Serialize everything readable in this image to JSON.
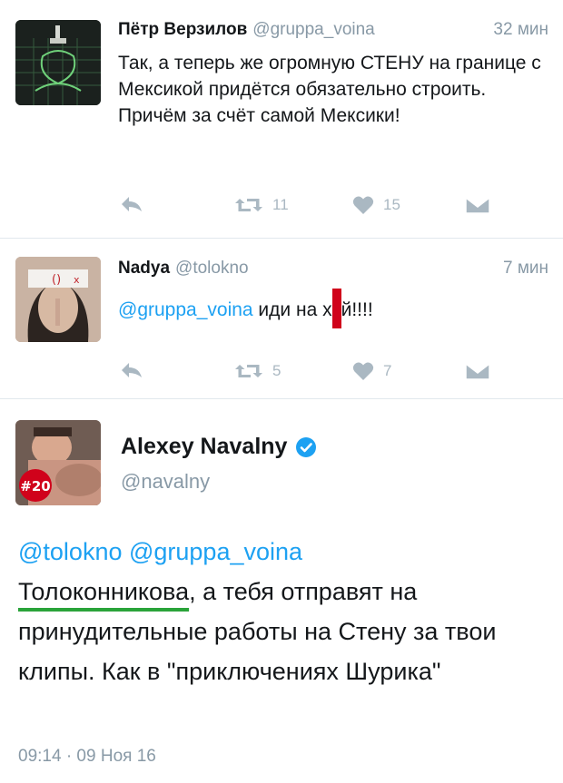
{
  "tweets": [
    {
      "name": "Пётр Верзилов",
      "handle": "@gruppa_voina",
      "time": "32 мин",
      "text": "Так, а теперь же огромную СТЕНУ на границе с Мексикой придётся обязательно строить. Причём за счёт самой Мексики!",
      "retweets": "11",
      "likes": "15"
    },
    {
      "name": "Nadya",
      "handle": "@tolokno",
      "time": "7 мин",
      "mention": "@gruppa_voina",
      "text_before": " иди на х",
      "text_after": "й!!!!",
      "retweets": "5",
      "likes": "7"
    }
  ],
  "main_tweet": {
    "name": "Alexey Navalny",
    "handle": "@navalny",
    "badge": "#20",
    "mentions": "@tolokno @gruppa_voina",
    "underlined_word": "Толоконникова",
    "text_rest": ", а тебя отправят на принудительные работы на Стену за твои клипы. Как в \"приключениях Шурика\"",
    "timestamp": "09:14 · 09 Ноя 16"
  },
  "colors": {
    "link": "#1da1f2",
    "verified": "#1da1f2",
    "censor": "#d0021b",
    "underline": "#2aa33a",
    "muted": "#8899a6",
    "icons": "#aab8c2"
  }
}
